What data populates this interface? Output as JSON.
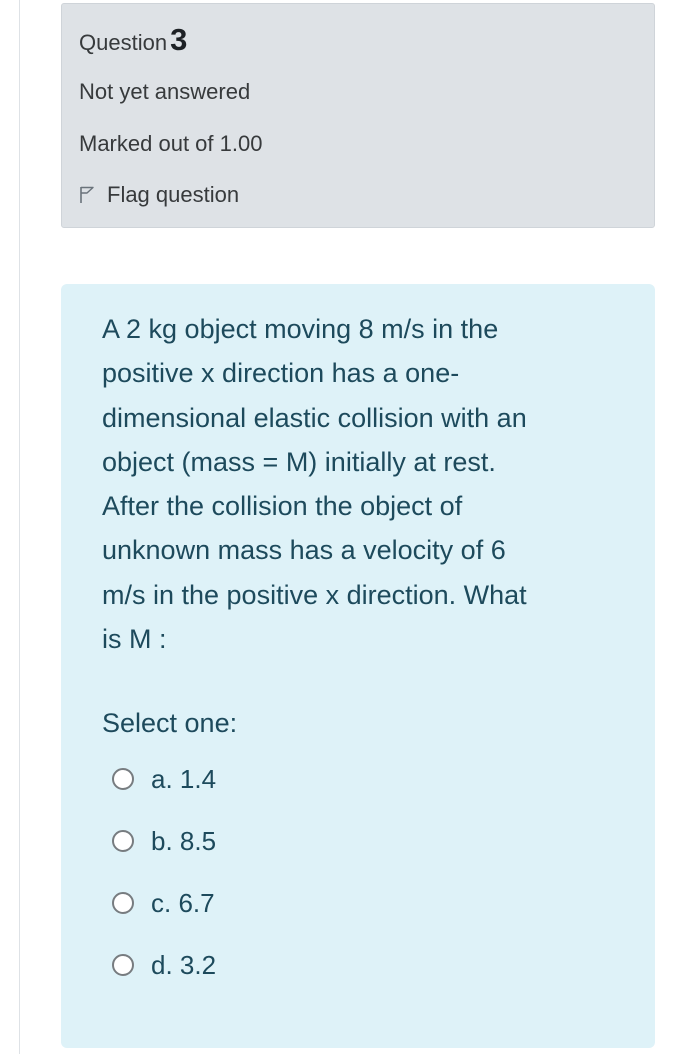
{
  "info": {
    "question_label": "Question",
    "question_number": "3",
    "state": "Not yet answered",
    "grade": "Marked out of 1.00",
    "flag_label": "Flag question"
  },
  "question": {
    "lines": [
      "A 2 kg object moving 8 m/s in the",
      "positive x direction has a one-",
      "dimensional elastic collision with an",
      "object (mass = M) initially at rest.",
      "After the collision the object of",
      "unknown mass has a velocity of 6",
      "m/s in the positive x direction. What",
      "is M :"
    ],
    "prompt": "Select one:",
    "answers": [
      {
        "label": "a. 1.4"
      },
      {
        "label": "b. 8.5"
      },
      {
        "label": "c. 6.7"
      },
      {
        "label": "d. 3.2"
      }
    ]
  },
  "colors": {
    "info_background": "#dee2e6",
    "content_background": "#def2f8",
    "text": "#1d4a5c"
  }
}
